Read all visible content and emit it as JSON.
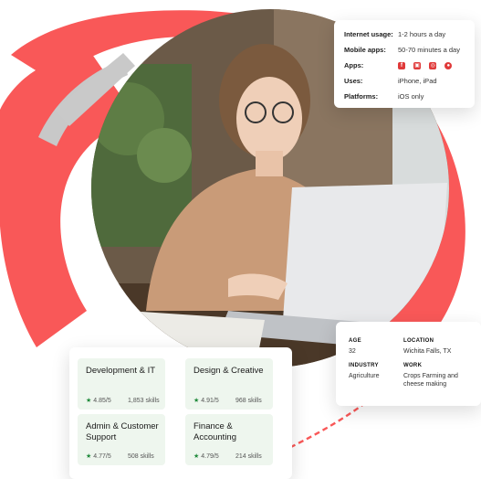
{
  "usage": {
    "rows": [
      {
        "label": "Internet usage:",
        "value": "1-2 hours a day"
      },
      {
        "label": "Mobile apps:",
        "value": "50-70 minutes a day"
      },
      {
        "label": "Apps:",
        "value": ""
      },
      {
        "label": "Uses:",
        "value": "iPhone, iPad"
      },
      {
        "label": "Platforms:",
        "value": "iOS only"
      }
    ],
    "apps": [
      "facebook-icon",
      "gift-icon",
      "instagram-icon",
      "whatsapp-icon"
    ]
  },
  "categories": [
    {
      "title": "Development & IT",
      "rating": "4.85/5",
      "skills": "1,853 skills"
    },
    {
      "title": "Design & Creative",
      "rating": "4.91/5",
      "skills": "968 skills"
    },
    {
      "title": "Admin & Customer Support",
      "rating": "4.77/5",
      "skills": "508 skills"
    },
    {
      "title": "Finance & Accounting",
      "rating": "4.79/5",
      "skills": "214 skills"
    }
  ],
  "profile": {
    "age_label": "AGE",
    "age_value": "32",
    "location_label": "LOCATION",
    "location_value": "Wichita Falls, TX",
    "industry_label": "INDUSTRY",
    "industry_value": "Agriculture",
    "work_label": "WORK",
    "work_value": "Crops Farming and cheese making"
  },
  "colors": {
    "accent": "#f95858",
    "grey": "#c8c8c8",
    "tile": "#eef6ee",
    "star": "#1f8a3a"
  }
}
